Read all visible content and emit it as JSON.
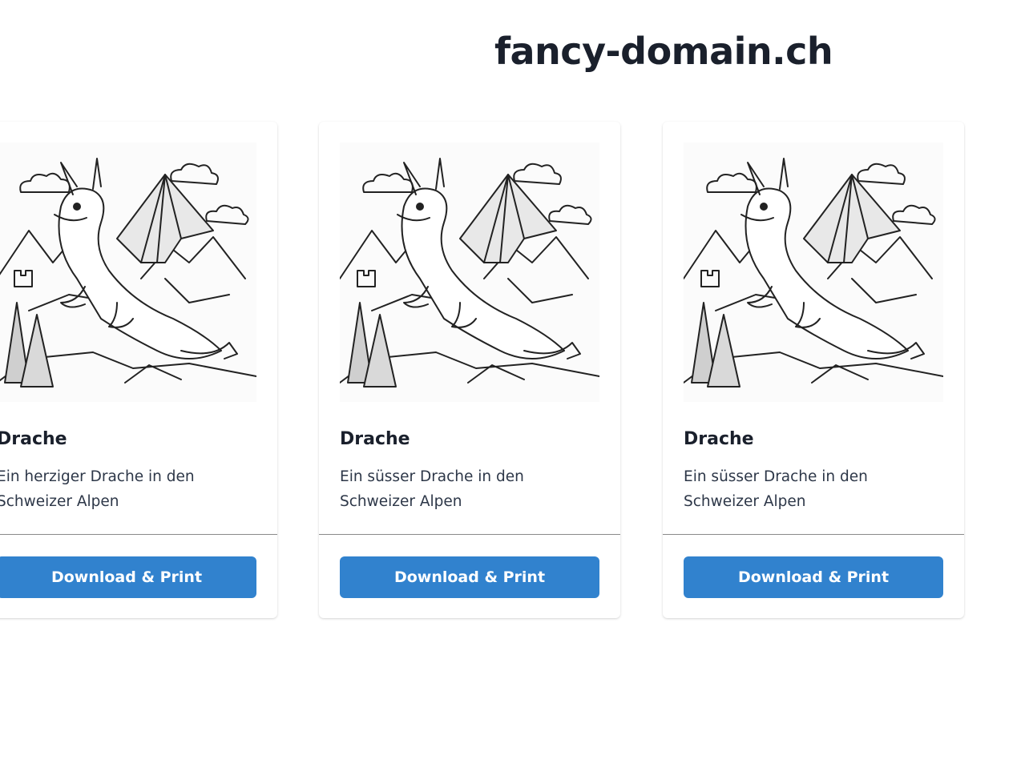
{
  "header": {
    "title": "fancy-domain.ch"
  },
  "cards": [
    {
      "image_icon": "dragon-illustration",
      "title": "Drache",
      "description": "Ein herziger Drache in den Schweizer Alpen",
      "button_label": "Download & Print"
    },
    {
      "image_icon": "dragon-illustration",
      "title": "Drache",
      "description": "Ein süsser Drache in den Schweizer Alpen",
      "button_label": "Download & Print"
    },
    {
      "image_icon": "dragon-illustration",
      "title": "Drache",
      "description": "Ein süsser Drache in den Schweizer Alpen",
      "button_label": "Download & Print"
    }
  ],
  "colors": {
    "button": "#3182ce",
    "text": "#1a202c"
  }
}
